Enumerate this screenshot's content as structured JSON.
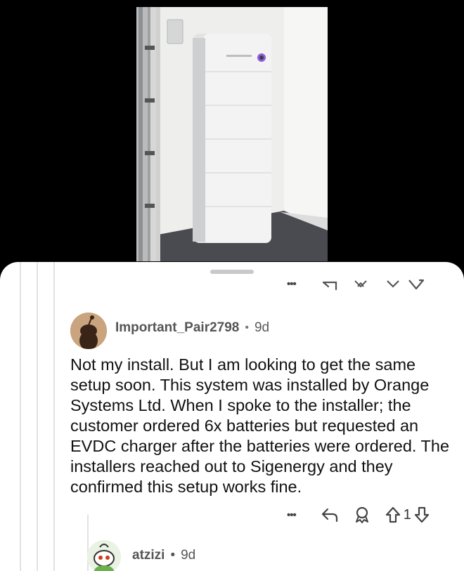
{
  "photo": {
    "description_icon": "photo-battery-install"
  },
  "previous_comment_actions": {
    "more_icon": "more-dots-icon",
    "reply_icon": "reply-icon",
    "award_icon": "award-icon",
    "upvote_icon": "upvote-icon",
    "downvote_icon": "downvote-icon"
  },
  "comment": {
    "username": "Important_Pair2798",
    "separator": "•",
    "age": "9d",
    "text": "Not my install. But I am looking to get the same setup soon. This system was installed by Orange Systems Ltd. When I spoke to the installer; the customer ordered 6x batteries but requested an EVDC charger after the batteries were ordered. The installers reached out to Sigenergy and they confirmed this setup works fine.",
    "more": "•••",
    "vote_count": "1"
  },
  "reply": {
    "username": "atzizi",
    "separator": "•",
    "age": "9d"
  },
  "colors": {
    "sheet": "#ffffff",
    "text": "#111111",
    "meta": "#5a5a5a",
    "thread_line": "#e2e2e2"
  }
}
